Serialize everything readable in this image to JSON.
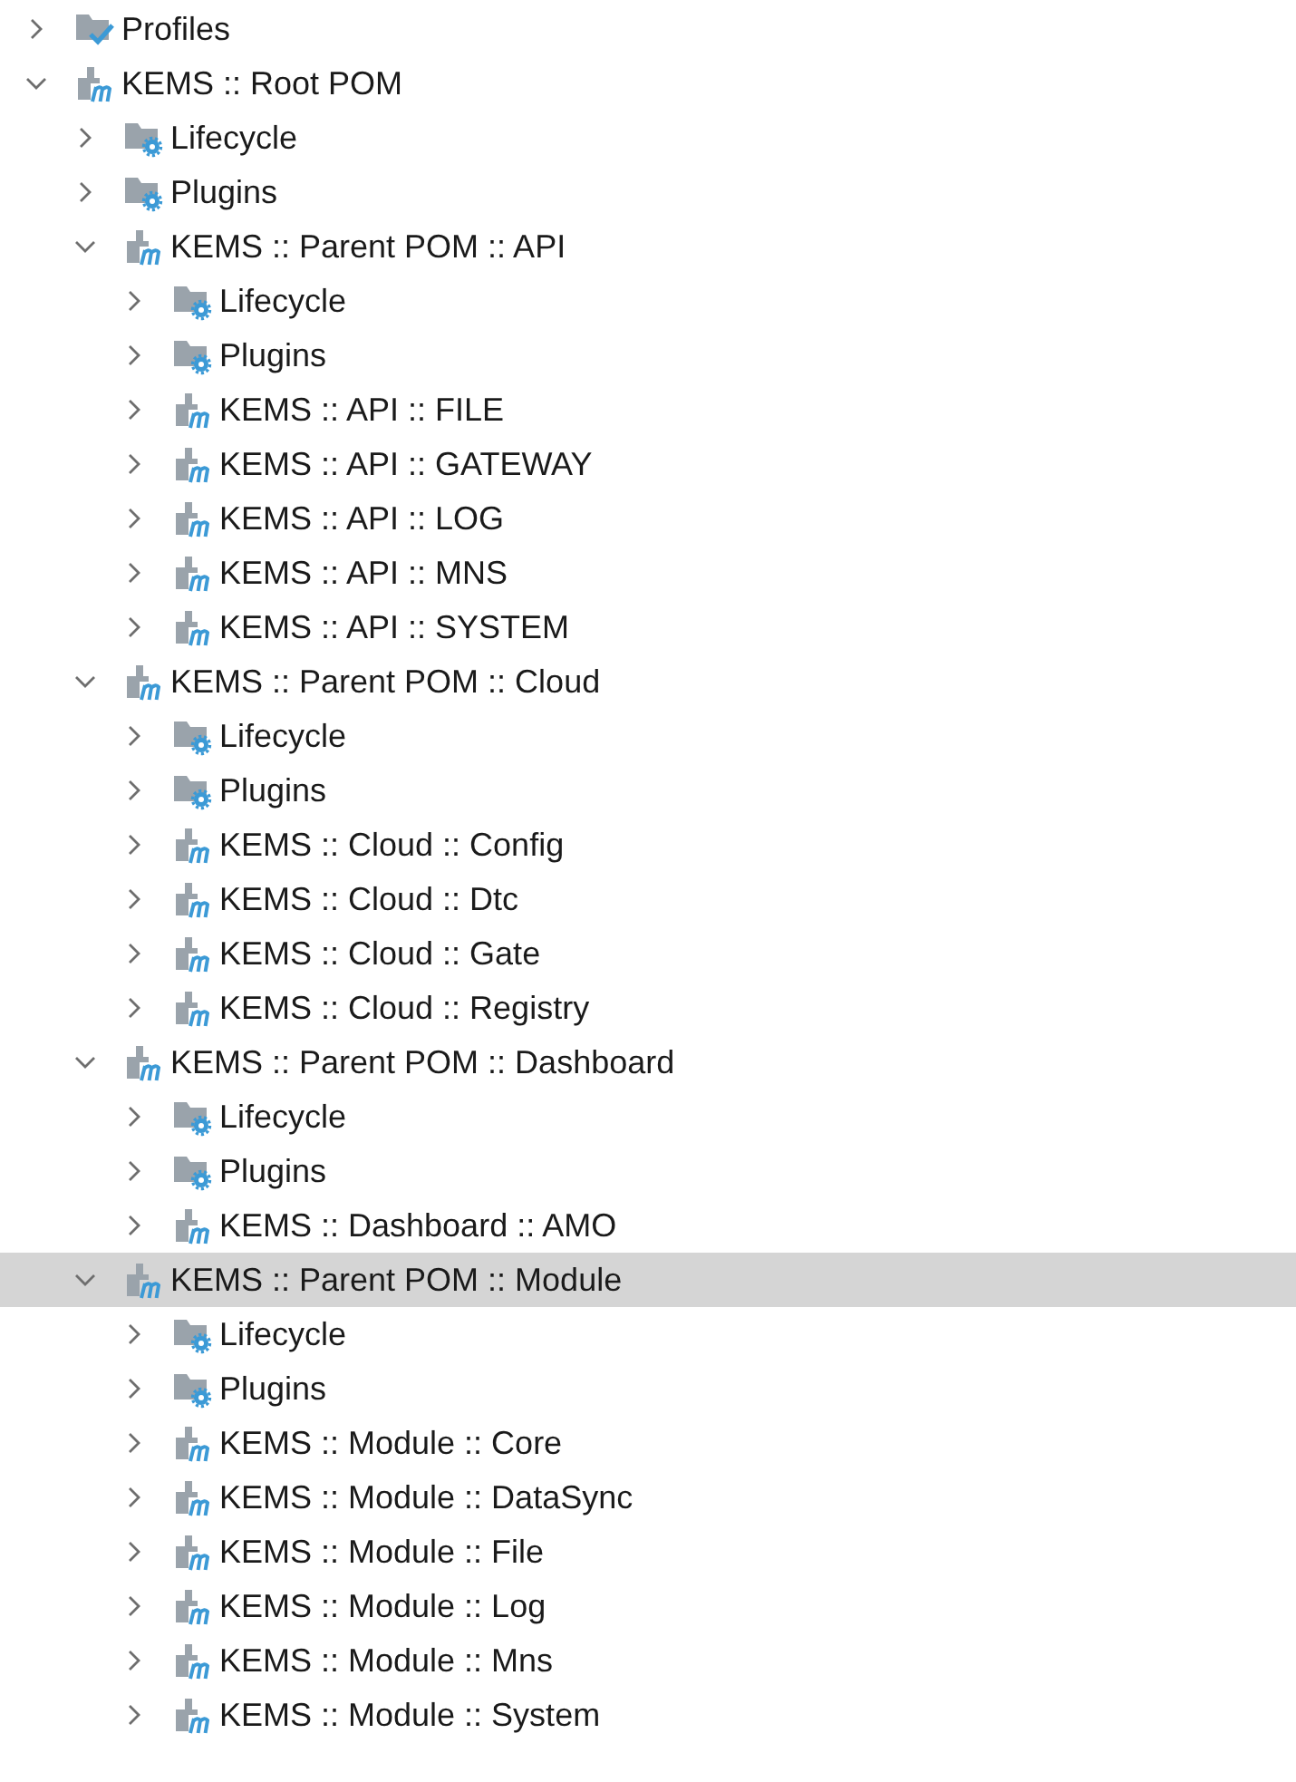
{
  "tree": [
    {
      "kind": "profiles",
      "label": "Profiles",
      "expanded": false,
      "selected": false
    },
    {
      "kind": "module",
      "label": "KEMS :: Root POM",
      "expanded": true,
      "selected": false,
      "children": [
        {
          "kind": "folder",
          "label": "Lifecycle",
          "expanded": false,
          "selected": false
        },
        {
          "kind": "folder",
          "label": "Plugins",
          "expanded": false,
          "selected": false
        },
        {
          "kind": "module",
          "label": "KEMS :: Parent POM :: API",
          "expanded": true,
          "selected": false,
          "children": [
            {
              "kind": "folder",
              "label": "Lifecycle",
              "expanded": false,
              "selected": false
            },
            {
              "kind": "folder",
              "label": "Plugins",
              "expanded": false,
              "selected": false
            },
            {
              "kind": "module",
              "label": "KEMS :: API :: FILE",
              "expanded": false,
              "selected": false
            },
            {
              "kind": "module",
              "label": "KEMS :: API :: GATEWAY",
              "expanded": false,
              "selected": false
            },
            {
              "kind": "module",
              "label": "KEMS :: API :: LOG",
              "expanded": false,
              "selected": false
            },
            {
              "kind": "module",
              "label": "KEMS :: API :: MNS",
              "expanded": false,
              "selected": false
            },
            {
              "kind": "module",
              "label": "KEMS :: API :: SYSTEM",
              "expanded": false,
              "selected": false
            }
          ]
        },
        {
          "kind": "module",
          "label": "KEMS :: Parent POM :: Cloud",
          "expanded": true,
          "selected": false,
          "children": [
            {
              "kind": "folder",
              "label": "Lifecycle",
              "expanded": false,
              "selected": false
            },
            {
              "kind": "folder",
              "label": "Plugins",
              "expanded": false,
              "selected": false
            },
            {
              "kind": "module",
              "label": "KEMS :: Cloud :: Config",
              "expanded": false,
              "selected": false
            },
            {
              "kind": "module",
              "label": "KEMS :: Cloud :: Dtc",
              "expanded": false,
              "selected": false
            },
            {
              "kind": "module",
              "label": "KEMS :: Cloud :: Gate",
              "expanded": false,
              "selected": false
            },
            {
              "kind": "module",
              "label": "KEMS :: Cloud :: Registry",
              "expanded": false,
              "selected": false
            }
          ]
        },
        {
          "kind": "module",
          "label": "KEMS :: Parent POM :: Dashboard",
          "expanded": true,
          "selected": false,
          "children": [
            {
              "kind": "folder",
              "label": "Lifecycle",
              "expanded": false,
              "selected": false
            },
            {
              "kind": "folder",
              "label": "Plugins",
              "expanded": false,
              "selected": false
            },
            {
              "kind": "module",
              "label": "KEMS :: Dashboard :: AMO",
              "expanded": false,
              "selected": false
            }
          ]
        },
        {
          "kind": "module",
          "label": "KEMS :: Parent POM :: Module",
          "expanded": true,
          "selected": true,
          "children": [
            {
              "kind": "folder",
              "label": "Lifecycle",
              "expanded": false,
              "selected": false
            },
            {
              "kind": "folder",
              "label": "Plugins",
              "expanded": false,
              "selected": false
            },
            {
              "kind": "module",
              "label": "KEMS :: Module :: Core",
              "expanded": false,
              "selected": false
            },
            {
              "kind": "module",
              "label": "KEMS :: Module :: DataSync",
              "expanded": false,
              "selected": false
            },
            {
              "kind": "module",
              "label": "KEMS :: Module :: File",
              "expanded": false,
              "selected": false
            },
            {
              "kind": "module",
              "label": "KEMS :: Module :: Log",
              "expanded": false,
              "selected": false
            },
            {
              "kind": "module",
              "label": "KEMS :: Module :: Mns",
              "expanded": false,
              "selected": false
            },
            {
              "kind": "module",
              "label": "KEMS :: Module :: System",
              "expanded": false,
              "selected": false
            }
          ]
        }
      ]
    }
  ]
}
